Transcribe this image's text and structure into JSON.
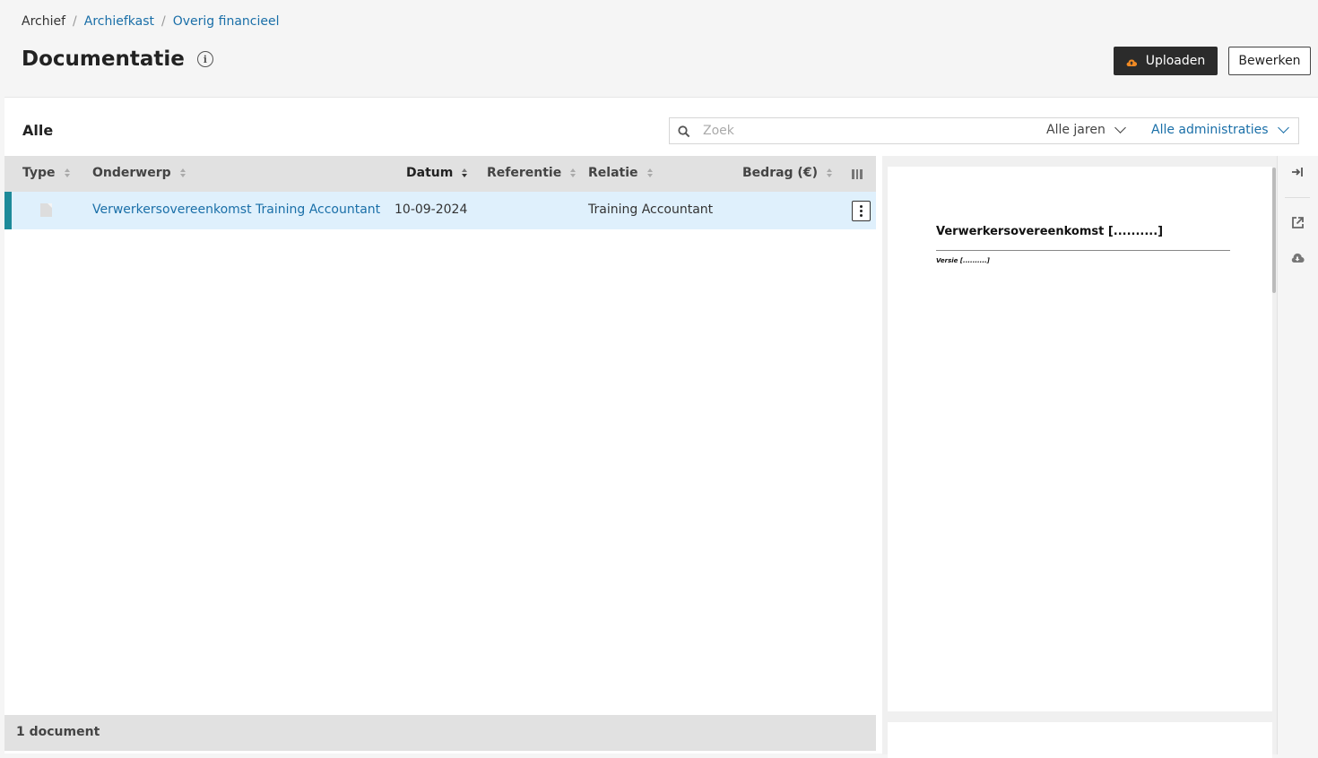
{
  "breadcrumb": {
    "root": "Archief",
    "items": [
      "Archiefkast",
      "Overig financieel"
    ]
  },
  "page": {
    "title": "Documentatie"
  },
  "actions": {
    "upload_label": "Uploaden",
    "edit_label": "Bewerken"
  },
  "filter": {
    "title": "Alle",
    "search_placeholder": "Zoek",
    "years": "Alle jaren",
    "administrations": "Alle administraties"
  },
  "table": {
    "columns": {
      "type": "Type",
      "subject": "Onderwerp",
      "date": "Datum",
      "reference": "Referentie",
      "relation": "Relatie",
      "amount": "Bedrag (€)"
    },
    "rows": [
      {
        "subject": "Verwerkersovereenkomst Training Accountant",
        "date": "10-09-2024",
        "reference": "",
        "relation": "Training Accountant",
        "amount": ""
      }
    ],
    "footer": "1 document"
  },
  "preview": {
    "doc_title": "Verwerkersovereenkomst [..........]",
    "doc_version": "Versie [..........]"
  },
  "colors": {
    "link": "#1a6fa8",
    "accent": "#1d8a99",
    "selected_row": "#dff0fc",
    "upload_button": "#2b2b2b",
    "upload_icon": "#f08a24"
  }
}
